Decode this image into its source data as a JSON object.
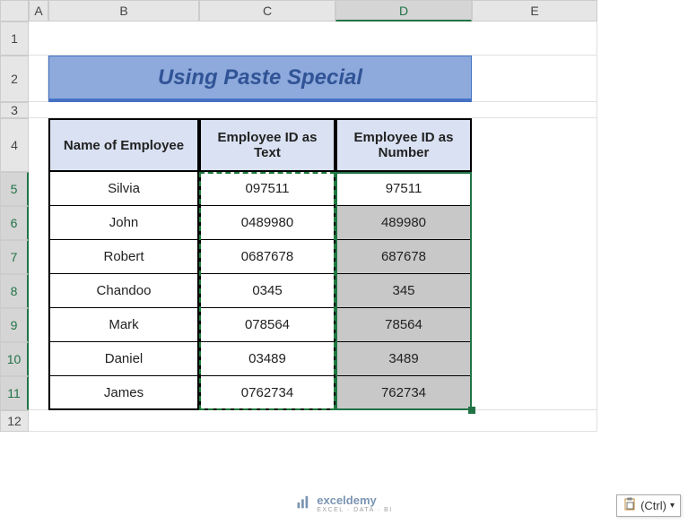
{
  "columns": [
    "A",
    "B",
    "C",
    "D",
    "E"
  ],
  "rows": [
    "1",
    "2",
    "3",
    "4",
    "5",
    "6",
    "7",
    "8",
    "9",
    "10",
    "11",
    "12"
  ],
  "selected_col": "D",
  "selected_rows": [
    "5",
    "6",
    "7",
    "8",
    "9",
    "10",
    "11"
  ],
  "title": "Using Paste Special",
  "headers": {
    "name": "Name of Employee",
    "id_text": "Employee ID as Text",
    "id_num": "Employee ID as Number"
  },
  "data": [
    {
      "name": "Silvia",
      "id_text": "097511",
      "id_num": "97511"
    },
    {
      "name": "John",
      "id_text": "0489980",
      "id_num": "489980"
    },
    {
      "name": "Robert",
      "id_text": "0687678",
      "id_num": "687678"
    },
    {
      "name": "Chandoo",
      "id_text": "0345",
      "id_num": "345"
    },
    {
      "name": "Mark",
      "id_text": "078564",
      "id_num": "78564"
    },
    {
      "name": "Daniel",
      "id_text": "03489",
      "id_num": "3489"
    },
    {
      "name": "James",
      "id_text": "0762734",
      "id_num": "762734"
    }
  ],
  "paste_options": {
    "label": "(Ctrl)"
  },
  "watermark": {
    "brand": "exceldemy",
    "tagline": "EXCEL · DATA · BI"
  }
}
